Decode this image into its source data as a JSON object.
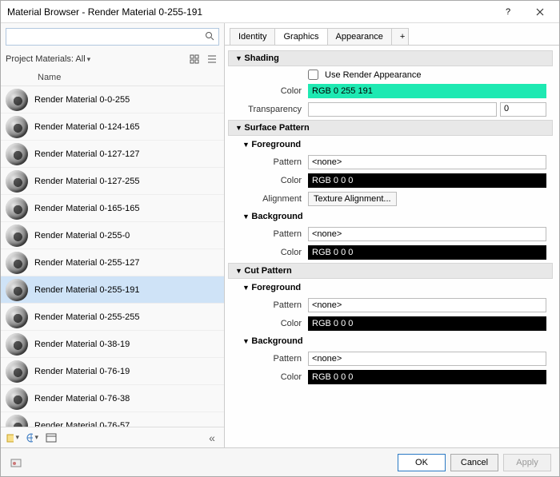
{
  "window": {
    "title": "Material Browser - Render Material 0-255-191"
  },
  "search": {
    "placeholder": ""
  },
  "filter": {
    "label": "Project Materials: All"
  },
  "list": {
    "header": "Name",
    "items": [
      "Render Material 0-0-255",
      "Render Material 0-124-165",
      "Render Material 0-127-127",
      "Render Material 0-127-255",
      "Render Material 0-165-165",
      "Render Material 0-255-0",
      "Render Material 0-255-127",
      "Render Material 0-255-191",
      "Render Material 0-255-255",
      "Render Material 0-38-19",
      "Render Material 0-76-19",
      "Render Material 0-76-38",
      "Render Material 0-76-57"
    ],
    "selected": 7
  },
  "tabs": {
    "items": [
      "Identity",
      "Graphics",
      "Appearance"
    ],
    "active": 1,
    "add": "+"
  },
  "sections": {
    "shading": {
      "title": "Shading",
      "useRender": {
        "label": "Use Render Appearance",
        "checked": false
      },
      "colorLabel": "Color",
      "colorValue": "RGB 0 255 191",
      "transpLabel": "Transparency",
      "transpValue": "0"
    },
    "surface": {
      "title": "Surface Pattern",
      "fg": {
        "title": "Foreground",
        "patternLabel": "Pattern",
        "patternValue": "<none>",
        "colorLabel": "Color",
        "colorValue": "RGB 0 0 0",
        "alignLabel": "Alignment",
        "alignBtn": "Texture Alignment..."
      },
      "bg": {
        "title": "Background",
        "patternLabel": "Pattern",
        "patternValue": "<none>",
        "colorLabel": "Color",
        "colorValue": "RGB 0 0 0"
      }
    },
    "cut": {
      "title": "Cut Pattern",
      "fg": {
        "title": "Foreground",
        "patternLabel": "Pattern",
        "patternValue": "<none>",
        "colorLabel": "Color",
        "colorValue": "RGB 0 0 0"
      },
      "bg": {
        "title": "Background",
        "patternLabel": "Pattern",
        "patternValue": "<none>",
        "colorLabel": "Color",
        "colorValue": "RGB 0 0 0"
      }
    }
  },
  "footer": {
    "ok": "OK",
    "cancel": "Cancel",
    "apply": "Apply"
  }
}
